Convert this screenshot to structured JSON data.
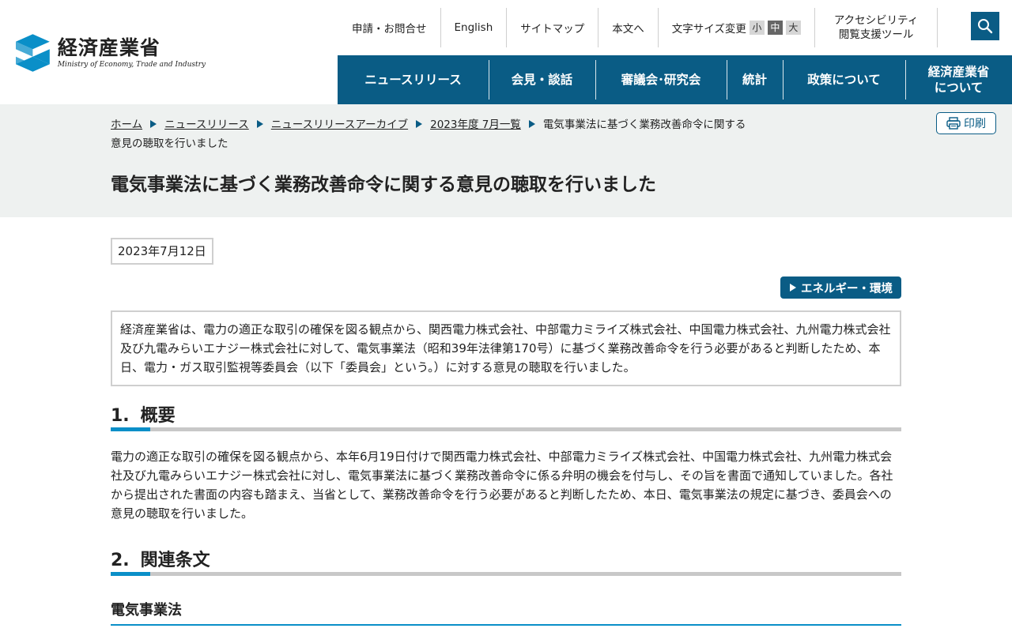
{
  "header": {
    "logo_ja": "経済産業省",
    "logo_en": "Ministry of Economy, Trade and Industry",
    "util": {
      "contact": "申請・お問合せ",
      "english": "English",
      "sitemap": "サイトマップ",
      "skip": "本文へ",
      "font_size_label": "文字サイズ変更",
      "font_small": "小",
      "font_medium": "中",
      "font_large": "大",
      "accessibility_line1": "アクセシビリティ",
      "accessibility_line2": "閲覧支援ツール"
    },
    "search_icon": "search-icon",
    "gnav": [
      {
        "label": "ニュースリリース"
      },
      {
        "label": "会見・談話"
      },
      {
        "label": "審議会･研究会"
      },
      {
        "label": "統計"
      },
      {
        "label": "政策について"
      },
      {
        "label_line1": "経済産業省",
        "label_line2": "について"
      }
    ]
  },
  "breadcrumb": {
    "items": [
      "ホーム",
      "ニュースリリース",
      "ニュースリリースアーカイブ",
      "2023年度 7月一覧"
    ],
    "current": "電気事業法に基づく業務改善命令に関する意見の聴取を行いました"
  },
  "print_label": "印刷",
  "page_title": "電気事業法に基づく業務改善命令に関する意見の聴取を行いました",
  "date": "2023年7月12日",
  "tag": "エネルギー・環境",
  "lead": "経済産業省は、電力の適正な取引の確保を図る観点から、関西電力株式会社、中部電力ミライズ株式会社、中国電力株式会社、九州電力株式会社及び九電みらいエナジー株式会社に対して、電気事業法（昭和39年法律第170号）に基づく業務改善命令を行う必要があると判断したため、本日、電力・ガス取引監視等委員会（以下「委員会」という。）に対する意見の聴取を行いました。",
  "section1": {
    "num": "1.",
    "title": "概要",
    "body": "電力の適正な取引の確保を図る観点から、本年6月19日付けで関西電力株式会社、中部電力ミライズ株式会社、中国電力株式会社、九州電力株式会社及び九電みらいエナジー株式会社に対し、電気事業法に基づく業務改善命令に係る弁明の機会を付与し、その旨を書面で通知していました。各社から提出された書面の内容も踏まえ、当省として、業務改善命令を行う必要があると判断したため、本日、電気事業法の規定に基づき、委員会への意見の聴取を行いました。"
  },
  "section2": {
    "num": "2.",
    "title": "関連条文",
    "subtitle": "電気事業法"
  },
  "colors": {
    "brand": "#0a5c85",
    "accent": "#0a8fc8",
    "band_bg": "#eef1f0"
  }
}
